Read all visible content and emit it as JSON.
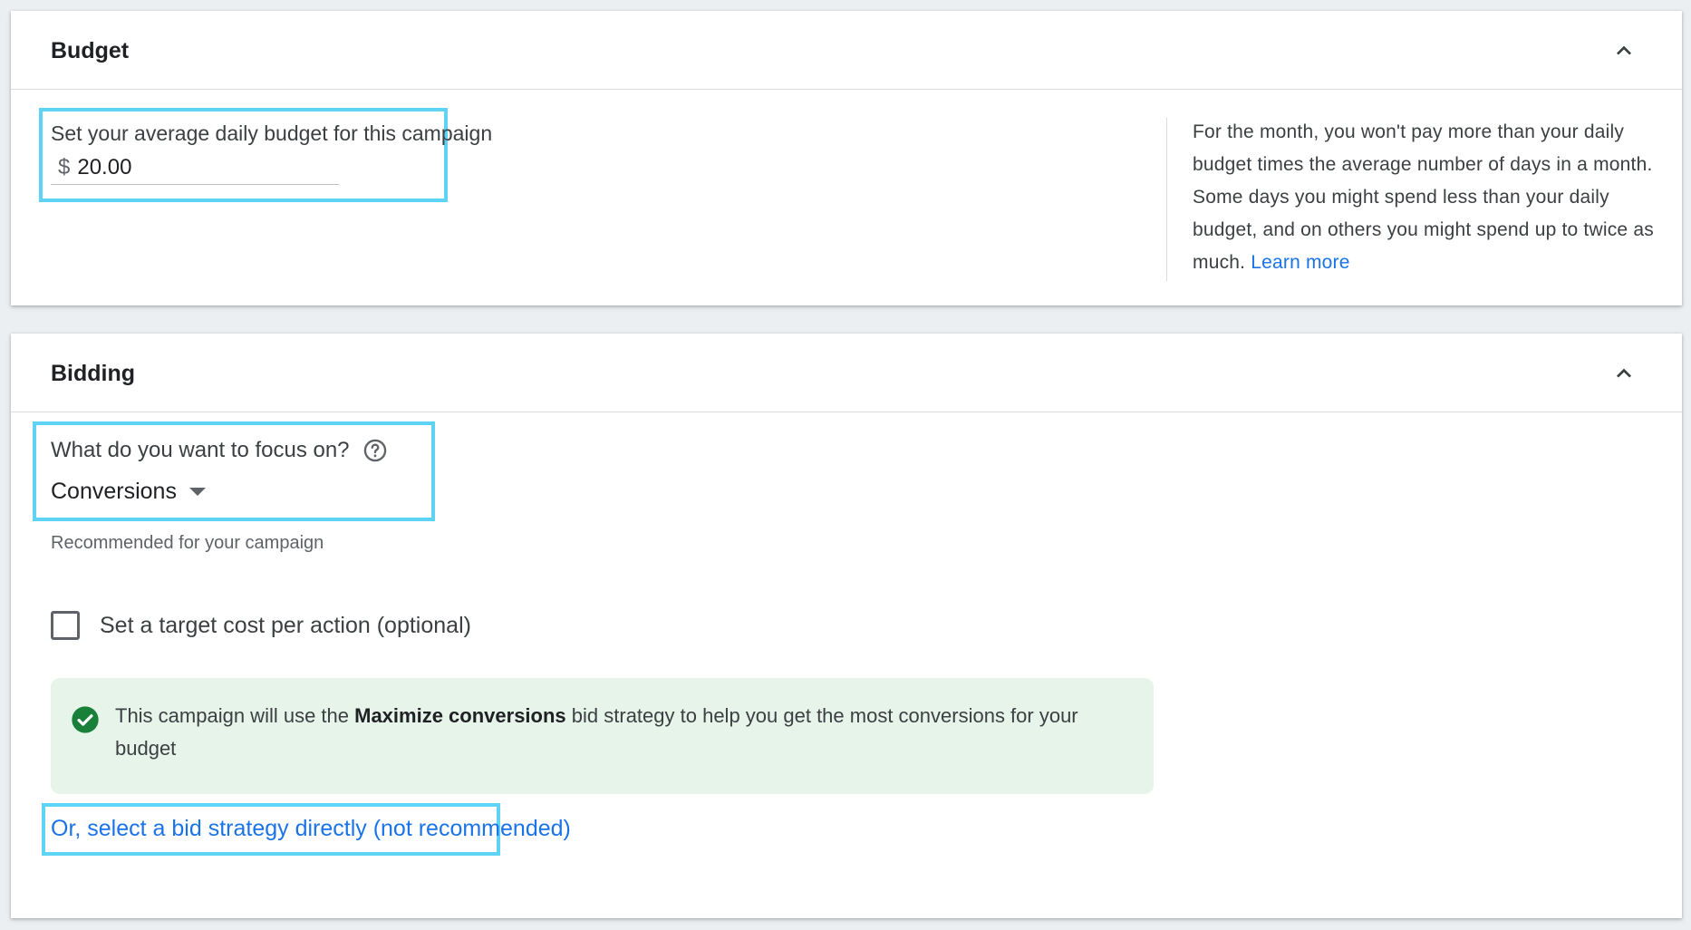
{
  "budget": {
    "title": "Budget",
    "field_label": "Set your average daily budget for this campaign",
    "currency_symbol": "$",
    "value": "20.00",
    "help_text": "For the month, you won't pay more than your daily budget times the average number of days in a month. Some days you might spend less than your daily budget, and on others you might spend up to twice as much.",
    "learn_more": "Learn more",
    "collapse_icon": "chevron-up-icon"
  },
  "bidding": {
    "title": "Bidding",
    "focus_label": "What do you want to focus on?",
    "help_icon": "help-circle-icon",
    "focus_value": "Conversions",
    "recommended_text": "Recommended for your campaign",
    "target_cpa_label": "Set a target cost per action (optional)",
    "target_cpa_checked": false,
    "info_prefix": "This campaign will use the ",
    "info_strategy": "Maximize conversions",
    "info_suffix": " bid strategy to help you get the most conversions for your budget",
    "select_strategy_link": "Or, select a bid strategy directly (not recommended)",
    "collapse_icon": "chevron-up-icon",
    "success_icon": "check-circle-icon"
  },
  "colors": {
    "highlight": "#5ed3f3",
    "link": "#1a73e8",
    "success_green": "#188038",
    "info_background": "#e6f4ea"
  }
}
